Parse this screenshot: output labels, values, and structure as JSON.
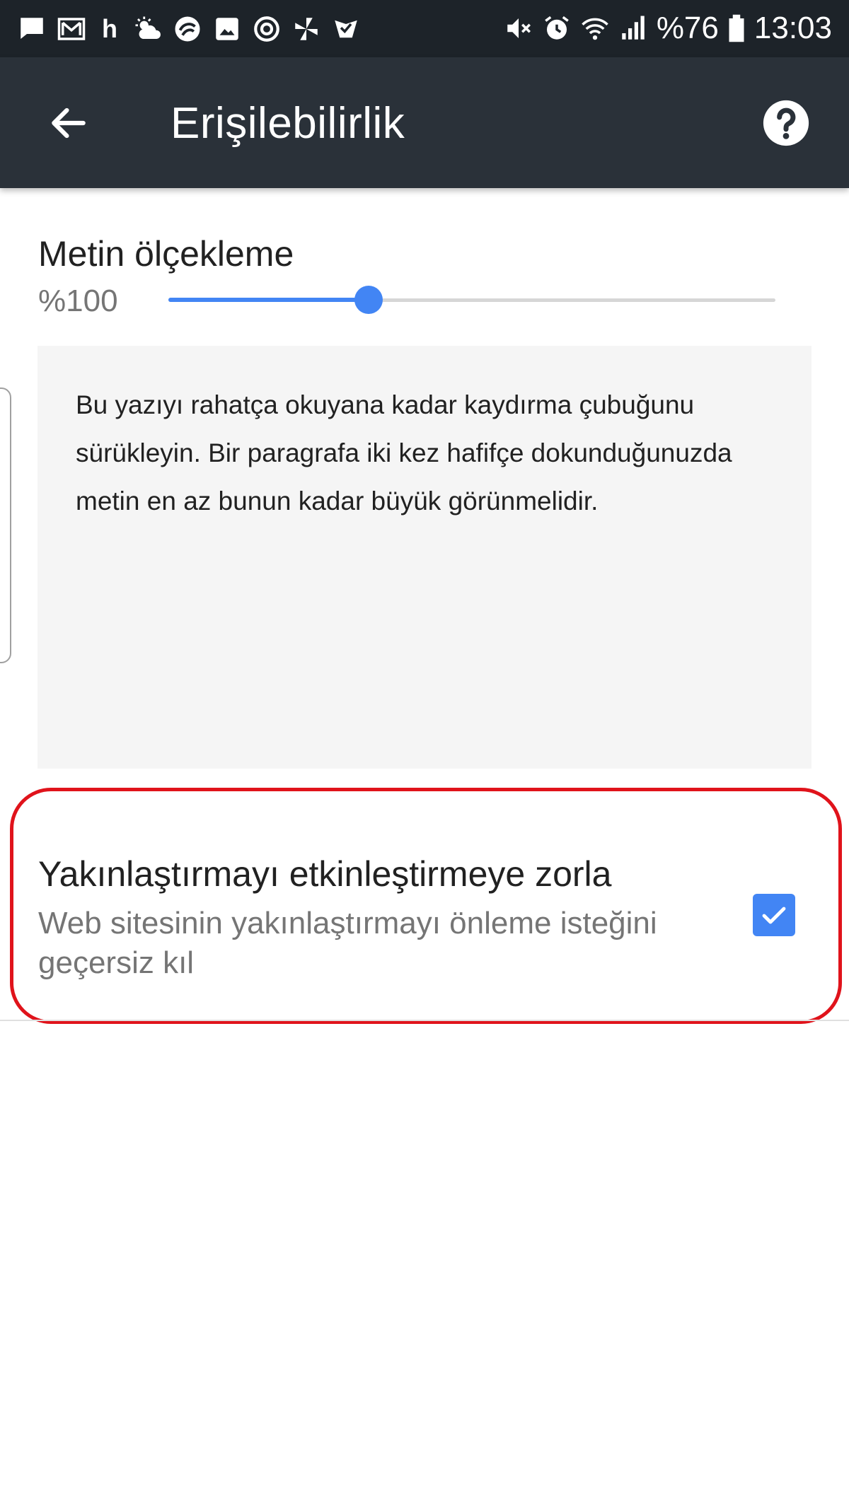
{
  "status_bar": {
    "left_icons": [
      "chat-icon",
      "gmail-icon",
      "h-app-icon",
      "weather-icon",
      "turkcell-icon",
      "gallery-icon",
      "sync-icon",
      "pinwheel-icon",
      "checkmark-app-icon"
    ],
    "h_label": "h",
    "right_icons": [
      "mute-icon",
      "alarm-icon",
      "wifi-icon",
      "signal-icon",
      "battery-icon"
    ],
    "battery": "%76",
    "time": "13:03"
  },
  "app_bar": {
    "title": "Erişilebilirlik",
    "back_icon": "arrow-back-icon",
    "help_icon": "help-circle-icon",
    "background": "#2a3139"
  },
  "text_scaling": {
    "title": "Metin ölçekleme",
    "value_label": "%100",
    "slider_fraction": 0.33,
    "accent": "#4285f4",
    "preview_text": "Bu yazıyı rahatça okuyana kadar kaydırma çubuğunu sürükleyin. Bir paragrafa iki kez hafifçe dokunduğunuzda metin en az bunun kadar büyük görünmelidir."
  },
  "force_zoom": {
    "title": "Yakınlaştırmayı etkinleştirmeye zorla",
    "summary": "Web sitesinin yakınlaştırmayı önleme isteğini geçersiz kıl",
    "checked": true,
    "highlight_color": "#e0131b"
  }
}
